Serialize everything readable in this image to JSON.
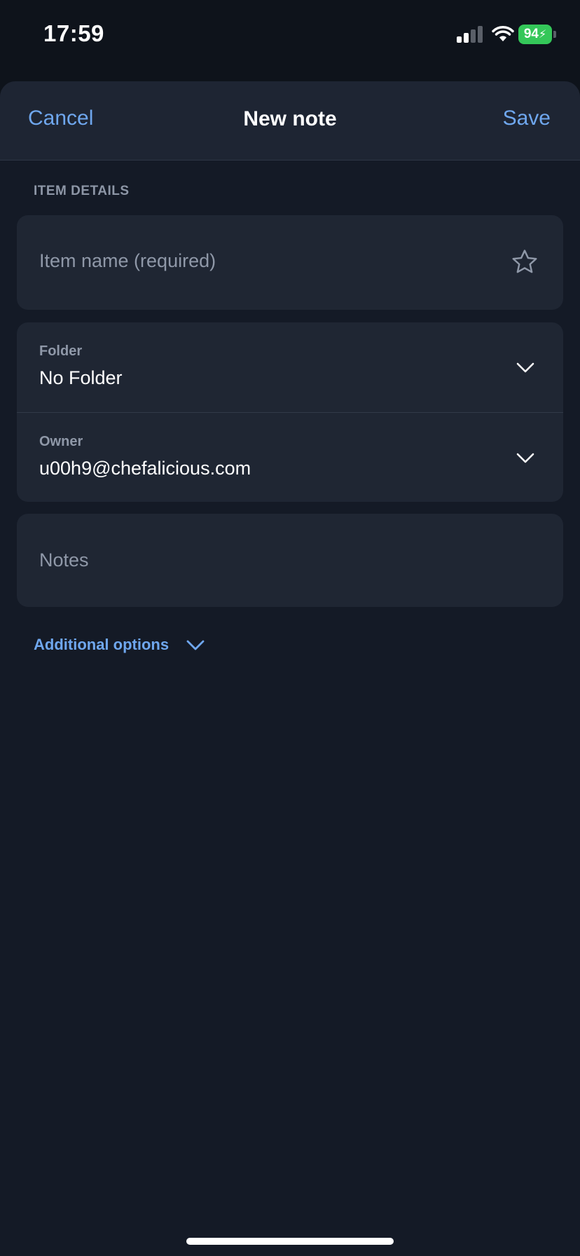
{
  "status_bar": {
    "time": "17:59",
    "battery": "94",
    "battery_color": "#34c759"
  },
  "nav": {
    "cancel_label": "Cancel",
    "title": "New note",
    "save_label": "Save"
  },
  "section": {
    "header": "ITEM DETAILS"
  },
  "item_name": {
    "placeholder": "Item name (required)",
    "favorite_icon": "star-icon"
  },
  "folder": {
    "label": "Folder",
    "value": "No Folder",
    "icon": "chevron-down-icon"
  },
  "owner": {
    "label": "Owner",
    "value": "u00h9@chefalicious.com",
    "icon": "chevron-down-icon"
  },
  "notes": {
    "placeholder": "Notes"
  },
  "additional_options": {
    "label": "Additional options",
    "icon": "chevron-down-icon"
  },
  "colors": {
    "accent": "#6fa7ee",
    "background": "#141a26",
    "card": "#1f2633"
  }
}
